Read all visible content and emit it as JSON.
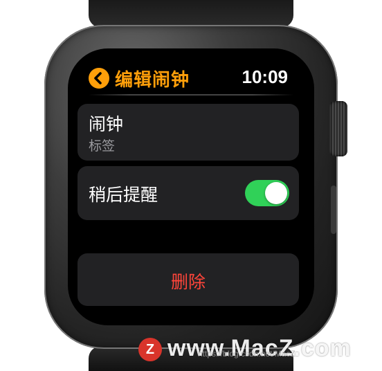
{
  "header": {
    "title": "编辑闹钟",
    "time": "10:09",
    "back_icon": "chevron-left-icon",
    "accent_color": "#ff9f0a"
  },
  "alarm_card": {
    "title": "闹钟",
    "subtitle": "标签"
  },
  "snooze_card": {
    "label": "稍后提醒",
    "toggle_on": true,
    "toggle_color": "#30d158"
  },
  "delete_card": {
    "label": "删除",
    "label_color": "#ff453a"
  },
  "watermark": {
    "logo_letter": "Z",
    "text": "www.MacZ.com",
    "url_overlay": "https://blog.csdn.net/MacZ"
  }
}
